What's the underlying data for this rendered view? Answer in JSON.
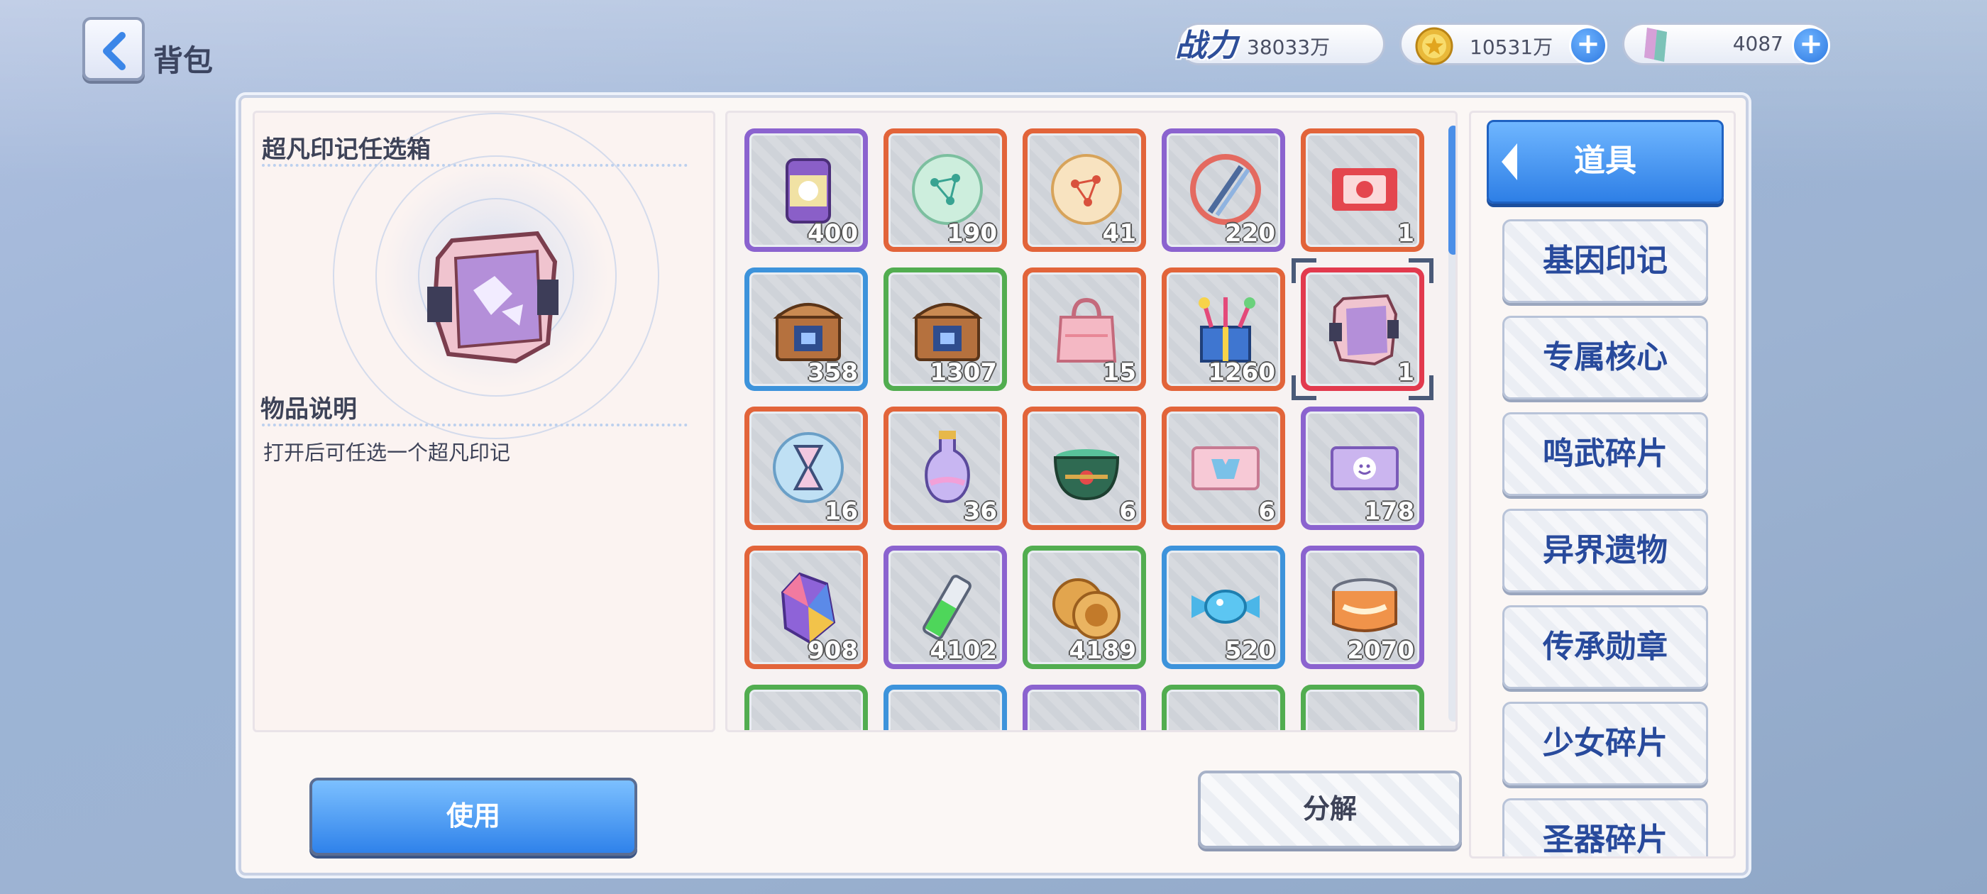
{
  "header": {
    "title": "背包",
    "power_label": "战力",
    "power_value": "38033万",
    "gold_value": "10531万",
    "gem_value": "4087"
  },
  "detail": {
    "item_name": "超凡印记任选箱",
    "desc_title": "物品说明",
    "desc_text": "打开后可任选一个超凡印记"
  },
  "items": [
    {
      "count": "400",
      "rarity": "purple",
      "icon": "can-icon"
    },
    {
      "count": "190",
      "rarity": "orange",
      "icon": "green-orb-icon"
    },
    {
      "count": "41",
      "rarity": "orange",
      "icon": "gold-orb-icon"
    },
    {
      "count": "220",
      "rarity": "purple",
      "icon": "dna-icon"
    },
    {
      "count": "1",
      "rarity": "orange",
      "icon": "red-ticket-icon"
    },
    {
      "count": "358",
      "rarity": "blue",
      "icon": "chest-icon"
    },
    {
      "count": "1307",
      "rarity": "green",
      "icon": "chest-icon"
    },
    {
      "count": "15",
      "rarity": "orange",
      "icon": "gift-bag-icon"
    },
    {
      "count": "1260",
      "rarity": "orange",
      "icon": "gift-box-icon"
    },
    {
      "count": "1",
      "rarity": "orange",
      "icon": "selection-box-icon",
      "selected": true
    },
    {
      "count": "16",
      "rarity": "orange",
      "icon": "hourglass-icon"
    },
    {
      "count": "36",
      "rarity": "orange",
      "icon": "potion-icon"
    },
    {
      "count": "6",
      "rarity": "orange",
      "icon": "cauldron-icon"
    },
    {
      "count": "6",
      "rarity": "orange",
      "icon": "pink-ticket-icon"
    },
    {
      "count": "178",
      "rarity": "purple",
      "icon": "purple-ticket-icon"
    },
    {
      "count": "908",
      "rarity": "orange",
      "icon": "crystal-icon"
    },
    {
      "count": "4102",
      "rarity": "purple",
      "icon": "vial-icon"
    },
    {
      "count": "4189",
      "rarity": "green",
      "icon": "cookie-icon"
    },
    {
      "count": "520",
      "rarity": "blue",
      "icon": "candy-icon"
    },
    {
      "count": "2070",
      "rarity": "purple",
      "icon": "tin-can-icon"
    },
    {
      "count": "",
      "rarity": "green",
      "icon": "misc-icon"
    },
    {
      "count": "",
      "rarity": "blue",
      "icon": "misc-icon"
    },
    {
      "count": "",
      "rarity": "purple",
      "icon": "misc-icon"
    },
    {
      "count": "",
      "rarity": "green",
      "icon": "misc-icon"
    },
    {
      "count": "",
      "rarity": "green",
      "icon": "misc-icon"
    }
  ],
  "categories": {
    "active": "道具",
    "list": [
      "基因印记",
      "专属核心",
      "鸣武碎片",
      "异界遗物",
      "传承勋章",
      "少女碎片",
      "圣器碎片"
    ]
  },
  "actions": {
    "use": "使用",
    "decompose": "分解"
  },
  "colors": {
    "purple": "#8b63cf",
    "orange": "#e2643a",
    "blue": "#3d93db",
    "green": "#52ad50",
    "accent": "#2f82ea"
  }
}
